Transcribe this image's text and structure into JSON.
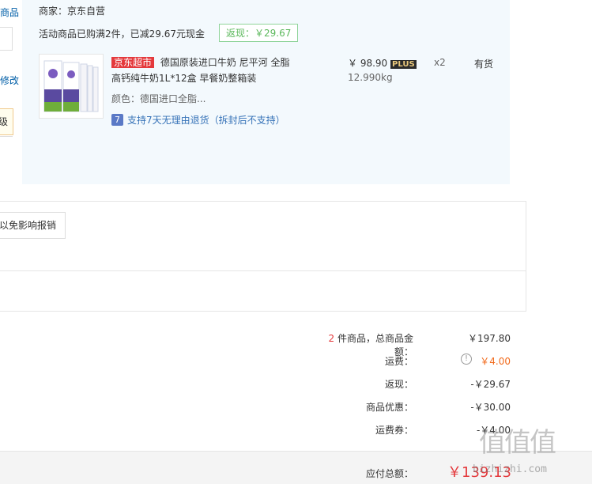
{
  "left_fragments": {
    "link1": "商品",
    "link2": "修改",
    "tip": "级"
  },
  "order": {
    "merchant": "商家：京东自营",
    "promo_text": "活动商品已购满2件，已减29.67元现金",
    "promo_badge": "返现：￥29.67",
    "item": {
      "store_tag": "京东超市",
      "title_line1": "德国原装进口牛奶 尼平河 全脂",
      "title_line2": "高钙纯牛奶1L*12盒 早餐奶整箱装",
      "color_attr": "颜色：德国进口全脂...",
      "return_policy": "支持7天无理由退货（拆封后不支持）",
      "return_icon": "7",
      "price": "￥ 98.90",
      "plus_badge": "PLUS",
      "weight": "12.990kg",
      "qty": "x2",
      "stock": "有货"
    }
  },
  "report_button": "以免影响报销",
  "summary": {
    "rows": [
      {
        "count": "2",
        "label": " 件商品，总商品金额：",
        "value": "￥197.80"
      },
      {
        "label": "运费：",
        "value": "￥4.00"
      },
      {
        "label": "返现：",
        "value": "-￥29.67"
      },
      {
        "label": "商品优惠：",
        "value": "-￥30.00"
      },
      {
        "label": "运费券：",
        "value": "-￥4.00"
      }
    ],
    "info_icon": "!",
    "total_label": "应付总额：",
    "total_value": "￥139.13"
  },
  "watermark": {
    "top": "值值值",
    "bottom": "bizhizhi.com"
  },
  "colors": {
    "accent_red": "#e4393c",
    "panel_blue": "#f3f9fd",
    "link_blue": "#005ea7",
    "promo_green": "#5cb85c"
  }
}
